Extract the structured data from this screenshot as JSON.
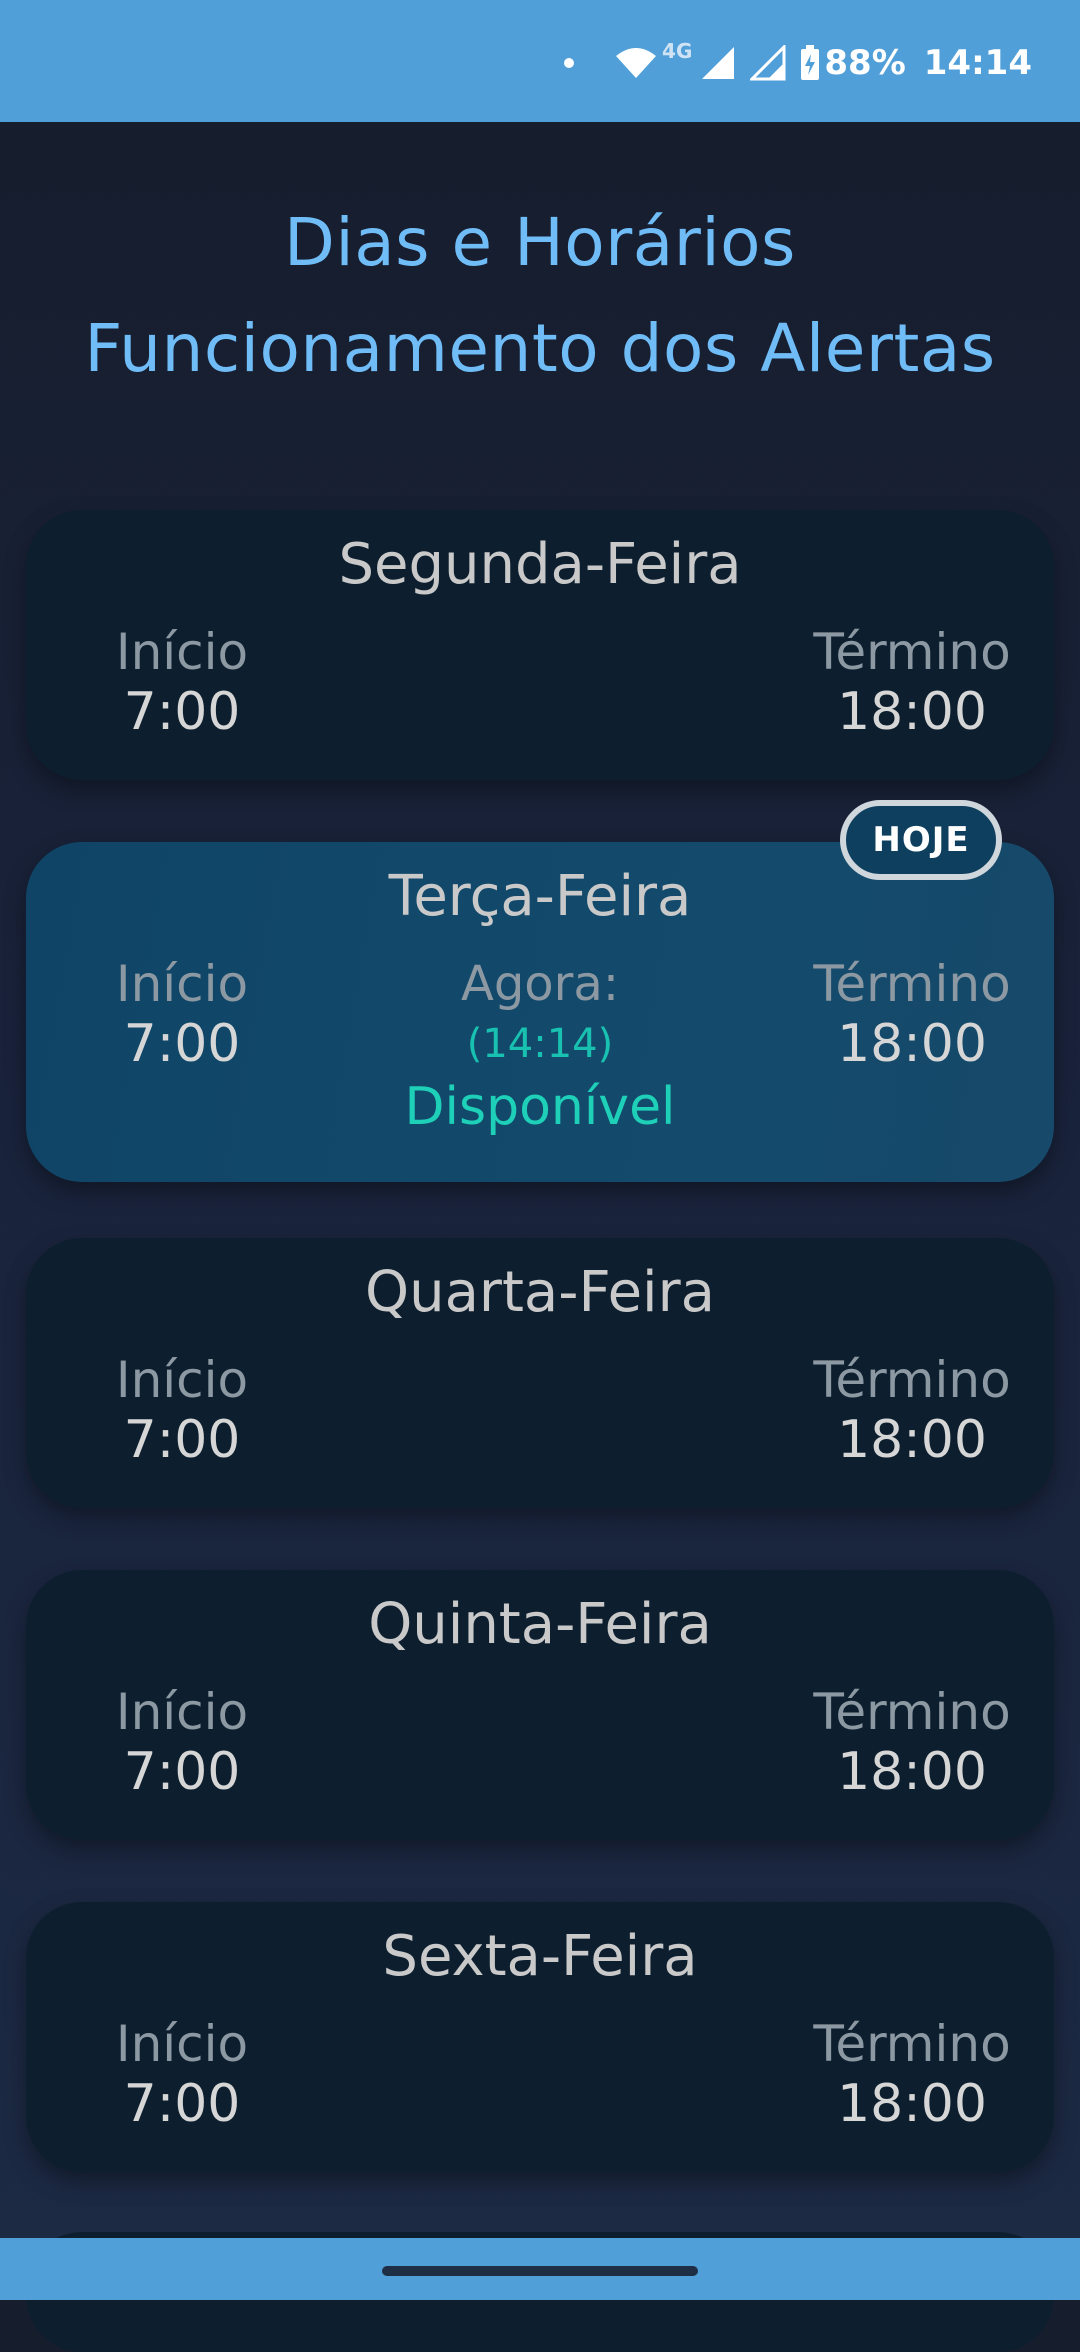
{
  "status_bar": {
    "network": "4G",
    "battery": "88%",
    "time": "14:14"
  },
  "title": {
    "line1": "Dias e Horários",
    "line2": "Funcionamento dos Alertas"
  },
  "labels": {
    "start": "Início",
    "end": "Término",
    "now": "Agora:",
    "today_badge": "HOJE"
  },
  "days": [
    {
      "name": "Segunda-Feira",
      "start": "7:00",
      "end": "18:00"
    },
    {
      "name": "Terça-Feira",
      "start": "7:00",
      "end": "18:00",
      "today": true,
      "now_time": "(14:14)",
      "status": "Disponível"
    },
    {
      "name": "Quarta-Feira",
      "start": "7:00",
      "end": "18:00"
    },
    {
      "name": "Quinta-Feira",
      "start": "7:00",
      "end": "18:00"
    },
    {
      "name": "Sexta-Feira",
      "start": "7:00",
      "end": "18:00"
    }
  ],
  "colors": {
    "status_bar": "#519fd8",
    "title": "#6fbcf7",
    "available": "#1ed0b8",
    "card": "#0d1f2f",
    "today_card": "#134a6c"
  }
}
